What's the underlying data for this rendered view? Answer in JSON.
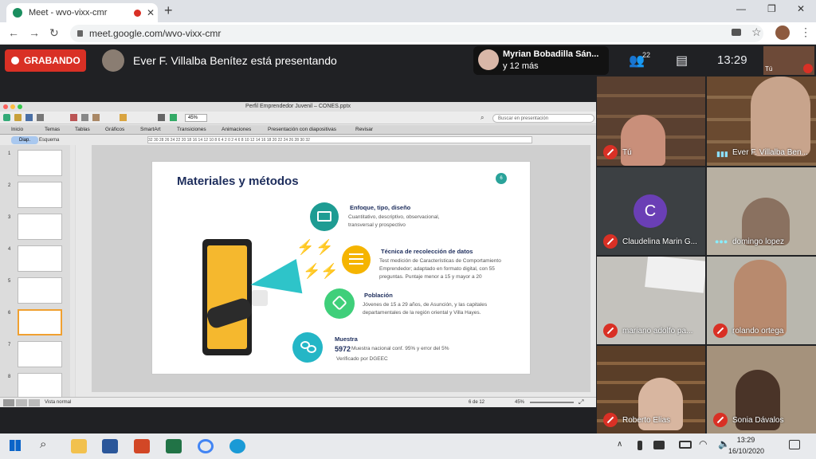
{
  "browser": {
    "tab_title": "Meet - wvo-vixx-cmr",
    "new_tab": "+",
    "close_tab": "✕",
    "url": "meet.google.com/wvo-vixx-cmr",
    "window_controls": [
      "—",
      "❐",
      "✕"
    ]
  },
  "meet": {
    "recording_label": "GRABANDO",
    "presenting_text": "Ever F. Villalba Benítez está presentando",
    "bubble_name": "Myrian Bobadilla Sán...",
    "bubble_more": "y 12 más",
    "people_count": "22",
    "time": "13:29",
    "self_label": "Tú",
    "participants": [
      {
        "name": "Tú",
        "muted": true,
        "color": "#6a5544"
      },
      {
        "name": "Ever F. Villalba Ben...",
        "muted": false,
        "color": "#5a4a3c"
      },
      {
        "name": "Claudelina Marin G...",
        "muted": true,
        "color": "#3c4043",
        "initial": "C",
        "avatar_color": "#6a3fb5"
      },
      {
        "name": "domingo lopez",
        "muted": false,
        "color": "#b8b0a2"
      },
      {
        "name": "mariano adolfo pa...",
        "muted": true,
        "color": "#c4c2bd"
      },
      {
        "name": "rolando ortega",
        "muted": true,
        "color": "#b9b7ae"
      },
      {
        "name": "Roberto Elias",
        "muted": true,
        "color": "#6b4e34"
      },
      {
        "name": "Sonia Dávalos",
        "muted": true,
        "color": "#a5927c"
      }
    ]
  },
  "ppt": {
    "window_title": "Perfil Emprendedor Juvenil – CONES.pptx",
    "search_placeholder": "Buscar en presentación",
    "zoom": "45%",
    "ribbon_tabs": [
      "Inicio",
      "Temas",
      "Tablas",
      "Gráficos",
      "SmartArt",
      "Transiciones",
      "Animaciones",
      "Presentación con diapositivas",
      "Revisar"
    ],
    "pane_tabs": [
      "Diap.",
      "Esquema"
    ],
    "ruler": "32  30  28  26  24  22  20  18  16  14  12  10  8  6  4  2  0  2  4  6  8  10  12  14  16  18  20  22  24  26  28  30  32",
    "thumb_numbers": [
      "1",
      "2",
      "3",
      "4",
      "5",
      "6",
      "7",
      "8"
    ],
    "status_view": "Vista normal",
    "status_page": "6 de 12",
    "status_zoom": "45%"
  },
  "slide": {
    "title": "Materiales y métodos",
    "number": "6",
    "items": [
      {
        "heading": "Enfoque, tipo, diseño",
        "body": "Cuantitativo, descriptivo, observacional, transversal y prospectivo",
        "color": "#1e9c93"
      },
      {
        "heading": "Técnica de recolección de datos",
        "body": "Test medición de Características de Comportamiento Emprendedor; adaptado en formato digital, con 55 preguntas. Puntaje menor a 15 y mayor a 20",
        "color": "#f5b400"
      },
      {
        "heading": "Población",
        "body": "Jóvenes de 15 a 29 años, de Asunción, y las capitales departamentales de la región oriental y Villa Hayes.",
        "color": "#3fcf7a"
      },
      {
        "heading": "Muestra",
        "number": "5972",
        "body": "Muestra nacional conf. 95% y error del 5%",
        "extra": "Verificado por DGEEC",
        "color": "#24b6c6"
      }
    ]
  },
  "taskbar": {
    "time": "13:29",
    "date": "16/10/2020"
  }
}
